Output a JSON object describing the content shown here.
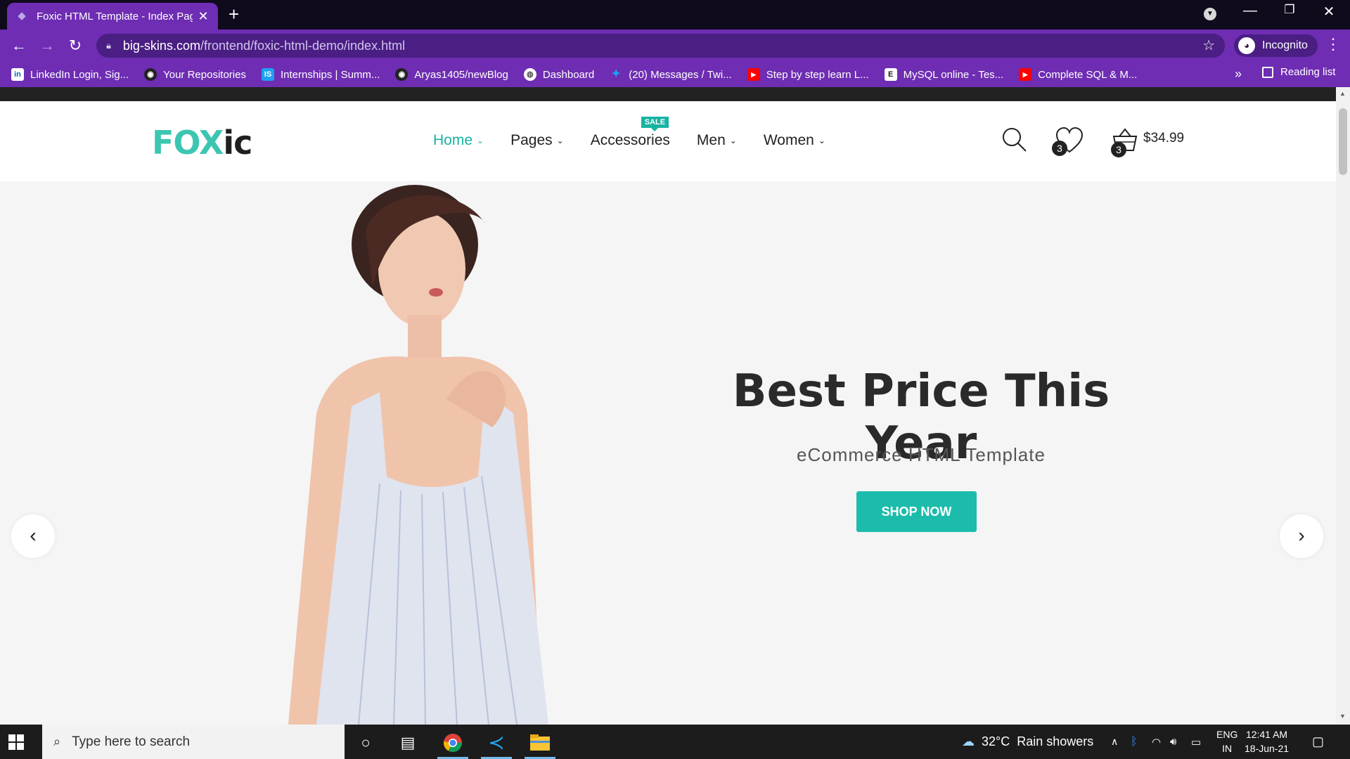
{
  "browser": {
    "tab_title": "Foxic HTML Template - Index Pag",
    "url_host": "big-skins.com",
    "url_path": "/frontend/foxic-html-demo/index.html",
    "profile_label": "Incognito",
    "reading_list": "Reading list",
    "bookmarks": [
      {
        "label": "LinkedIn Login, Sig...",
        "icon": "linkedin-icon"
      },
      {
        "label": "Your Repositories",
        "icon": "github-icon"
      },
      {
        "label": "Internships | Summ...",
        "icon": "internshala-icon"
      },
      {
        "label": "Aryas1405/newBlog",
        "icon": "github-icon"
      },
      {
        "label": "Dashboard",
        "icon": "globe-icon"
      },
      {
        "label": "(20) Messages / Twi...",
        "icon": "twitter-icon"
      },
      {
        "label": "Step by step learn L...",
        "icon": "youtube-icon"
      },
      {
        "label": "MySQL online - Tes...",
        "icon": "e-icon"
      },
      {
        "label": "Complete SQL & M...",
        "icon": "youtube-icon"
      }
    ]
  },
  "site": {
    "logo_part1": "FOX",
    "logo_part2": "ic",
    "menu": [
      {
        "label": "Home",
        "active": true,
        "dropdown": true
      },
      {
        "label": "Pages",
        "active": false,
        "dropdown": true
      },
      {
        "label": "Accessories",
        "active": false,
        "dropdown": false,
        "badge": "SALE"
      },
      {
        "label": "Men",
        "active": false,
        "dropdown": true
      },
      {
        "label": "Women",
        "active": false,
        "dropdown": true
      }
    ],
    "wishlist_count": "3",
    "cart_count": "3",
    "cart_total": "$34.99",
    "accent_color": "#17b3a3"
  },
  "hero": {
    "title": "Best Price This Year",
    "subtitle": "eCommerce HTML Template",
    "cta": "SHOP NOW",
    "slide_count": 3,
    "active_slide": 1
  },
  "taskbar": {
    "search_placeholder": "Type here to search",
    "weather": "32°C  Rain showers",
    "lang_line1": "ENG",
    "lang_line2": "IN",
    "time": "12:41 AM",
    "date": "18-Jun-21"
  }
}
